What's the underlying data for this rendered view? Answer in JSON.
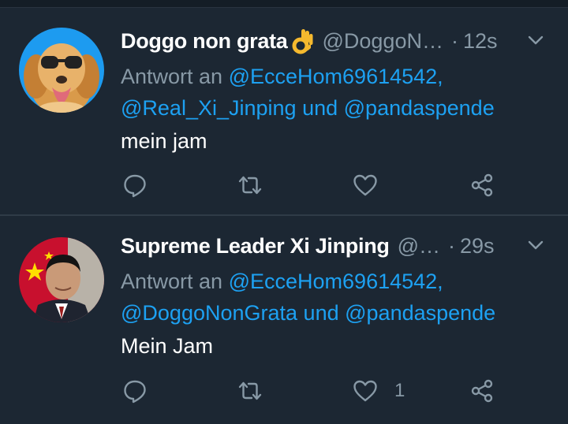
{
  "tweets": [
    {
      "display_name": "Doggo non grata",
      "emoji": "ok-hand-emoji",
      "handle": "@DoggoN…",
      "separator": "·",
      "time": "12s",
      "reply_prefix": "Antwort an",
      "reply_line1_mention": "@EcceHom69614542,",
      "reply_line2_mention1": "@Real_Xi_Jinping",
      "reply_conjunction": "und",
      "reply_line2_mention2": "@pandaspende",
      "text": "mein jam",
      "like_count": ""
    },
    {
      "display_name": "Supreme Leader Xi Jinping",
      "handle": "@…",
      "separator": "·",
      "time": "29s",
      "reply_prefix": "Antwort an",
      "reply_line1_mention": "@EcceHom69614542,",
      "reply_line2_mention1": "@DoggoNonGrata",
      "reply_conjunction": "und",
      "reply_line2_mention2": "@pandaspende",
      "text": "Mein Jam",
      "like_count": "1"
    }
  ],
  "colors": {
    "background": "#1c2733",
    "name": "#ffffff",
    "secondary": "#8899a6",
    "link": "#1da1f2"
  },
  "icons": [
    "reply-icon",
    "retweet-icon",
    "like-icon",
    "share-icon",
    "chevron-down-icon"
  ]
}
